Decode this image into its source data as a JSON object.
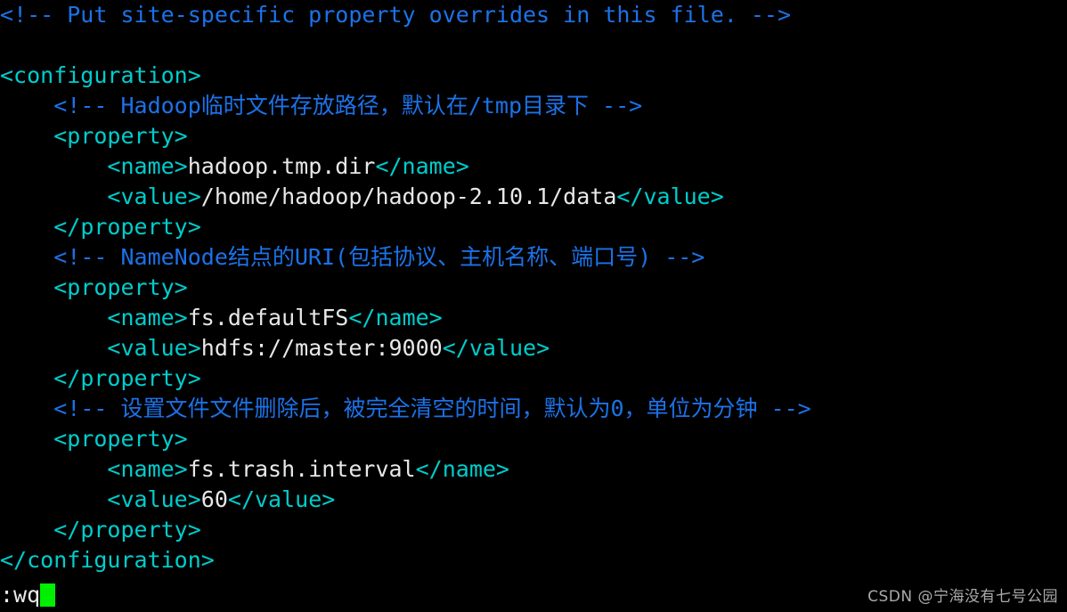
{
  "app": {
    "kind": "terminal-vim-editor",
    "mode_command": ":wq",
    "background_color": "#000000"
  },
  "colors": {
    "tag": "#00cdcd",
    "comment": "#1c72e8",
    "text": "#e8e8e8",
    "cursor": "#00ef00",
    "watermark": "#b9b9b9"
  },
  "editor": {
    "file_kind": "xml",
    "lines": [
      {
        "indent": 0,
        "segments": [
          {
            "style": "comment",
            "text": "<!-- Put site-specific property overrides in this file. -->"
          }
        ]
      },
      {
        "indent": 0,
        "segments": [
          {
            "style": "blank",
            "text": ""
          }
        ]
      },
      {
        "indent": 0,
        "segments": [
          {
            "style": "tag",
            "text": "<configuration>"
          }
        ]
      },
      {
        "indent": 4,
        "segments": [
          {
            "style": "comment",
            "text": "<!-- Hadoop临时文件存放路径，默认在/tmp目录下 -->"
          }
        ]
      },
      {
        "indent": 4,
        "segments": [
          {
            "style": "tag",
            "text": "<property>"
          }
        ]
      },
      {
        "indent": 8,
        "segments": [
          {
            "style": "tag",
            "text": "<name>"
          },
          {
            "style": "text",
            "text": "hadoop.tmp.dir"
          },
          {
            "style": "tag",
            "text": "</name>"
          }
        ]
      },
      {
        "indent": 8,
        "segments": [
          {
            "style": "tag",
            "text": "<value>"
          },
          {
            "style": "text",
            "text": "/home/hadoop/hadoop-2.10.1/data"
          },
          {
            "style": "tag",
            "text": "</value>"
          }
        ]
      },
      {
        "indent": 4,
        "segments": [
          {
            "style": "tag",
            "text": "</property>"
          }
        ]
      },
      {
        "indent": 4,
        "segments": [
          {
            "style": "comment",
            "text": "<!-- NameNode结点的URI(包括协议、主机名称、端口号) -->"
          }
        ]
      },
      {
        "indent": 4,
        "segments": [
          {
            "style": "tag",
            "text": "<property>"
          }
        ]
      },
      {
        "indent": 8,
        "segments": [
          {
            "style": "tag",
            "text": "<name>"
          },
          {
            "style": "text",
            "text": "fs.defaultFS"
          },
          {
            "style": "tag",
            "text": "</name>"
          }
        ]
      },
      {
        "indent": 8,
        "segments": [
          {
            "style": "tag",
            "text": "<value>"
          },
          {
            "style": "text",
            "text": "hdfs://master:9000"
          },
          {
            "style": "tag",
            "text": "</value>"
          }
        ]
      },
      {
        "indent": 4,
        "segments": [
          {
            "style": "tag",
            "text": "</property>"
          }
        ]
      },
      {
        "indent": 4,
        "segments": [
          {
            "style": "comment",
            "text": "<!-- 设置文件文件删除后，被完全清空的时间，默认为0，单位为分钟 -->"
          }
        ]
      },
      {
        "indent": 4,
        "segments": [
          {
            "style": "tag",
            "text": "<property>"
          }
        ]
      },
      {
        "indent": 8,
        "segments": [
          {
            "style": "tag",
            "text": "<name>"
          },
          {
            "style": "text",
            "text": "fs.trash.interval"
          },
          {
            "style": "tag",
            "text": "</name>"
          }
        ]
      },
      {
        "indent": 8,
        "segments": [
          {
            "style": "tag",
            "text": "<value>"
          },
          {
            "style": "text",
            "text": "60"
          },
          {
            "style": "tag",
            "text": "</value>"
          }
        ]
      },
      {
        "indent": 4,
        "segments": [
          {
            "style": "tag",
            "text": "</property>"
          }
        ]
      },
      {
        "indent": 0,
        "segments": [
          {
            "style": "tag",
            "text": "</configuration>"
          }
        ]
      }
    ]
  },
  "statusline": {
    "command_text": ":wq",
    "cursor_visible": true
  },
  "watermark": {
    "text": "CSDN @宁海没有七号公园"
  }
}
